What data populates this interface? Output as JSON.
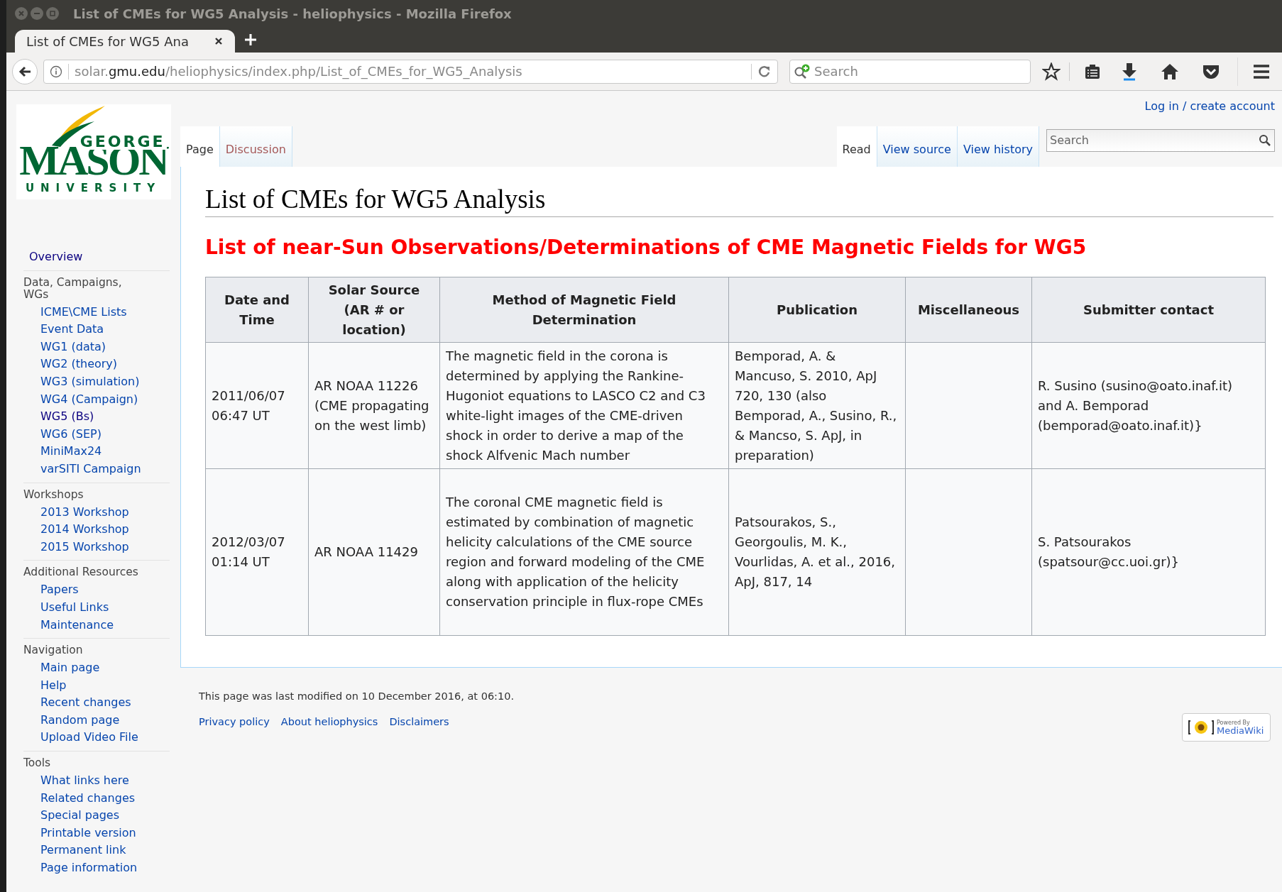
{
  "window": {
    "title": "List of CMEs for WG5 Analysis - heliophysics - Mozilla Firefox"
  },
  "browser_tabs": [
    {
      "label": "List of CMEs for WG5 Ana",
      "selected": true
    }
  ],
  "address_bar": {
    "url_parts": [
      "solar.",
      "gmu.edu",
      "/heliophysics/index.php/List_of_CMEs_for_WG5_Analysis"
    ]
  },
  "browser_search": {
    "placeholder": "Search"
  },
  "personal_tools": [
    "Log in / create account"
  ],
  "page_tabs": [
    {
      "label": "Page",
      "selected": true,
      "redlink": false
    },
    {
      "label": "Discussion",
      "selected": false,
      "redlink": true
    }
  ],
  "view_tabs": [
    {
      "label": "Read",
      "selected": true
    },
    {
      "label": "View source",
      "selected": false
    },
    {
      "label": "View history",
      "selected": false
    }
  ],
  "wiki_search": {
    "placeholder": "Search"
  },
  "logo": {
    "line1": "GEORGE",
    "line2": "MASON",
    "line3": "UNIVERSITY"
  },
  "sidebar": [
    {
      "items": [
        {
          "label": "Overview",
          "visited": true
        }
      ]
    },
    {
      "heading": "Data, Campaigns, WGs",
      "items": [
        {
          "label": "ICME\\CME Lists",
          "visited": false
        },
        {
          "label": "Event Data",
          "visited": false
        },
        {
          "label": "WG1 (data)",
          "visited": false
        },
        {
          "label": "WG2 (theory)",
          "visited": false
        },
        {
          "label": "WG3 (simulation)",
          "visited": false
        },
        {
          "label": "WG4 (Campaign)",
          "visited": false
        },
        {
          "label": "WG5 (Bs)",
          "visited": true
        },
        {
          "label": "WG6 (SEP)",
          "visited": false
        },
        {
          "label": "MiniMax24",
          "visited": false
        },
        {
          "label": "varSITI Campaign",
          "visited": false
        }
      ]
    },
    {
      "heading": "Workshops",
      "items": [
        {
          "label": "2013 Workshop",
          "visited": false
        },
        {
          "label": "2014 Workshop",
          "visited": false
        },
        {
          "label": "2015 Workshop",
          "visited": false
        }
      ]
    },
    {
      "heading": "Additional Resources",
      "items": [
        {
          "label": "Papers",
          "visited": false
        },
        {
          "label": "Useful Links",
          "visited": false
        },
        {
          "label": "Maintenance",
          "visited": false
        }
      ]
    },
    {
      "heading": "Navigation",
      "items": [
        {
          "label": "Main page",
          "visited": false
        },
        {
          "label": "Help",
          "visited": false
        },
        {
          "label": "Recent changes",
          "visited": false
        },
        {
          "label": "Random page",
          "visited": false
        },
        {
          "label": "Upload Video File",
          "visited": false
        }
      ]
    },
    {
      "heading": "Tools",
      "items": [
        {
          "label": "What links here",
          "visited": false
        },
        {
          "label": "Related changes",
          "visited": false
        },
        {
          "label": "Special pages",
          "visited": false
        },
        {
          "label": "Printable version",
          "visited": false
        },
        {
          "label": "Permanent link",
          "visited": false
        },
        {
          "label": "Page information",
          "visited": false
        }
      ]
    }
  ],
  "page_title": "List of CMEs for WG5 Analysis",
  "section_heading": "List of near-Sun Observations/Determinations of CME Magnetic Fields for WG5",
  "table": {
    "columns": [
      "Date and Time",
      "Solar Source (AR # or location)",
      "Method of Magnetic Field Determination",
      "Publication",
      "Miscellaneous",
      "Submitter contact"
    ],
    "rows": [
      [
        "2011/06/07 06:47 UT",
        "AR NOAA 11226 (CME propagating on the west limb)",
        "The magnetic field in the corona is determined by applying the Rankine-Hugoniot equations to LASCO C2 and C3 white-light images of the CME-driven shock in order to derive a map of the shock Alfvenic Mach number",
        "Bemporad, A. & Mancuso, S. 2010, ApJ 720, 130 (also Bemporad, A., Susino, R., & Mancso, S. ApJ, in preparation)",
        "",
        "R. Susino (susino@oato.inaf.it) and A. Bemporad (bemporad@oato.inaf.it)}"
      ],
      [
        "2012/03/07 01:14 UT",
        "AR NOAA 11429",
        "The coronal CME magnetic field is estimated by combination of magnetic helicity calculations of the CME source region and forward modeling of the CME along with application of the helicity conservation principle in flux-rope CMEs",
        "Patsourakos, S., Georgoulis, M. K., Vourlidas, A. et al., 2016, ApJ, 817, 14",
        "",
        "S. Patsourakos (spatsour@cc.uoi.gr)}"
      ]
    ]
  },
  "footer": {
    "last_modified": "This page was last modified on 10 December 2016, at 06:10.",
    "links": [
      "Privacy policy",
      "About heliophysics",
      "Disclaimers"
    ],
    "badge": {
      "small": "Powered By",
      "large": "MediaWiki"
    }
  }
}
